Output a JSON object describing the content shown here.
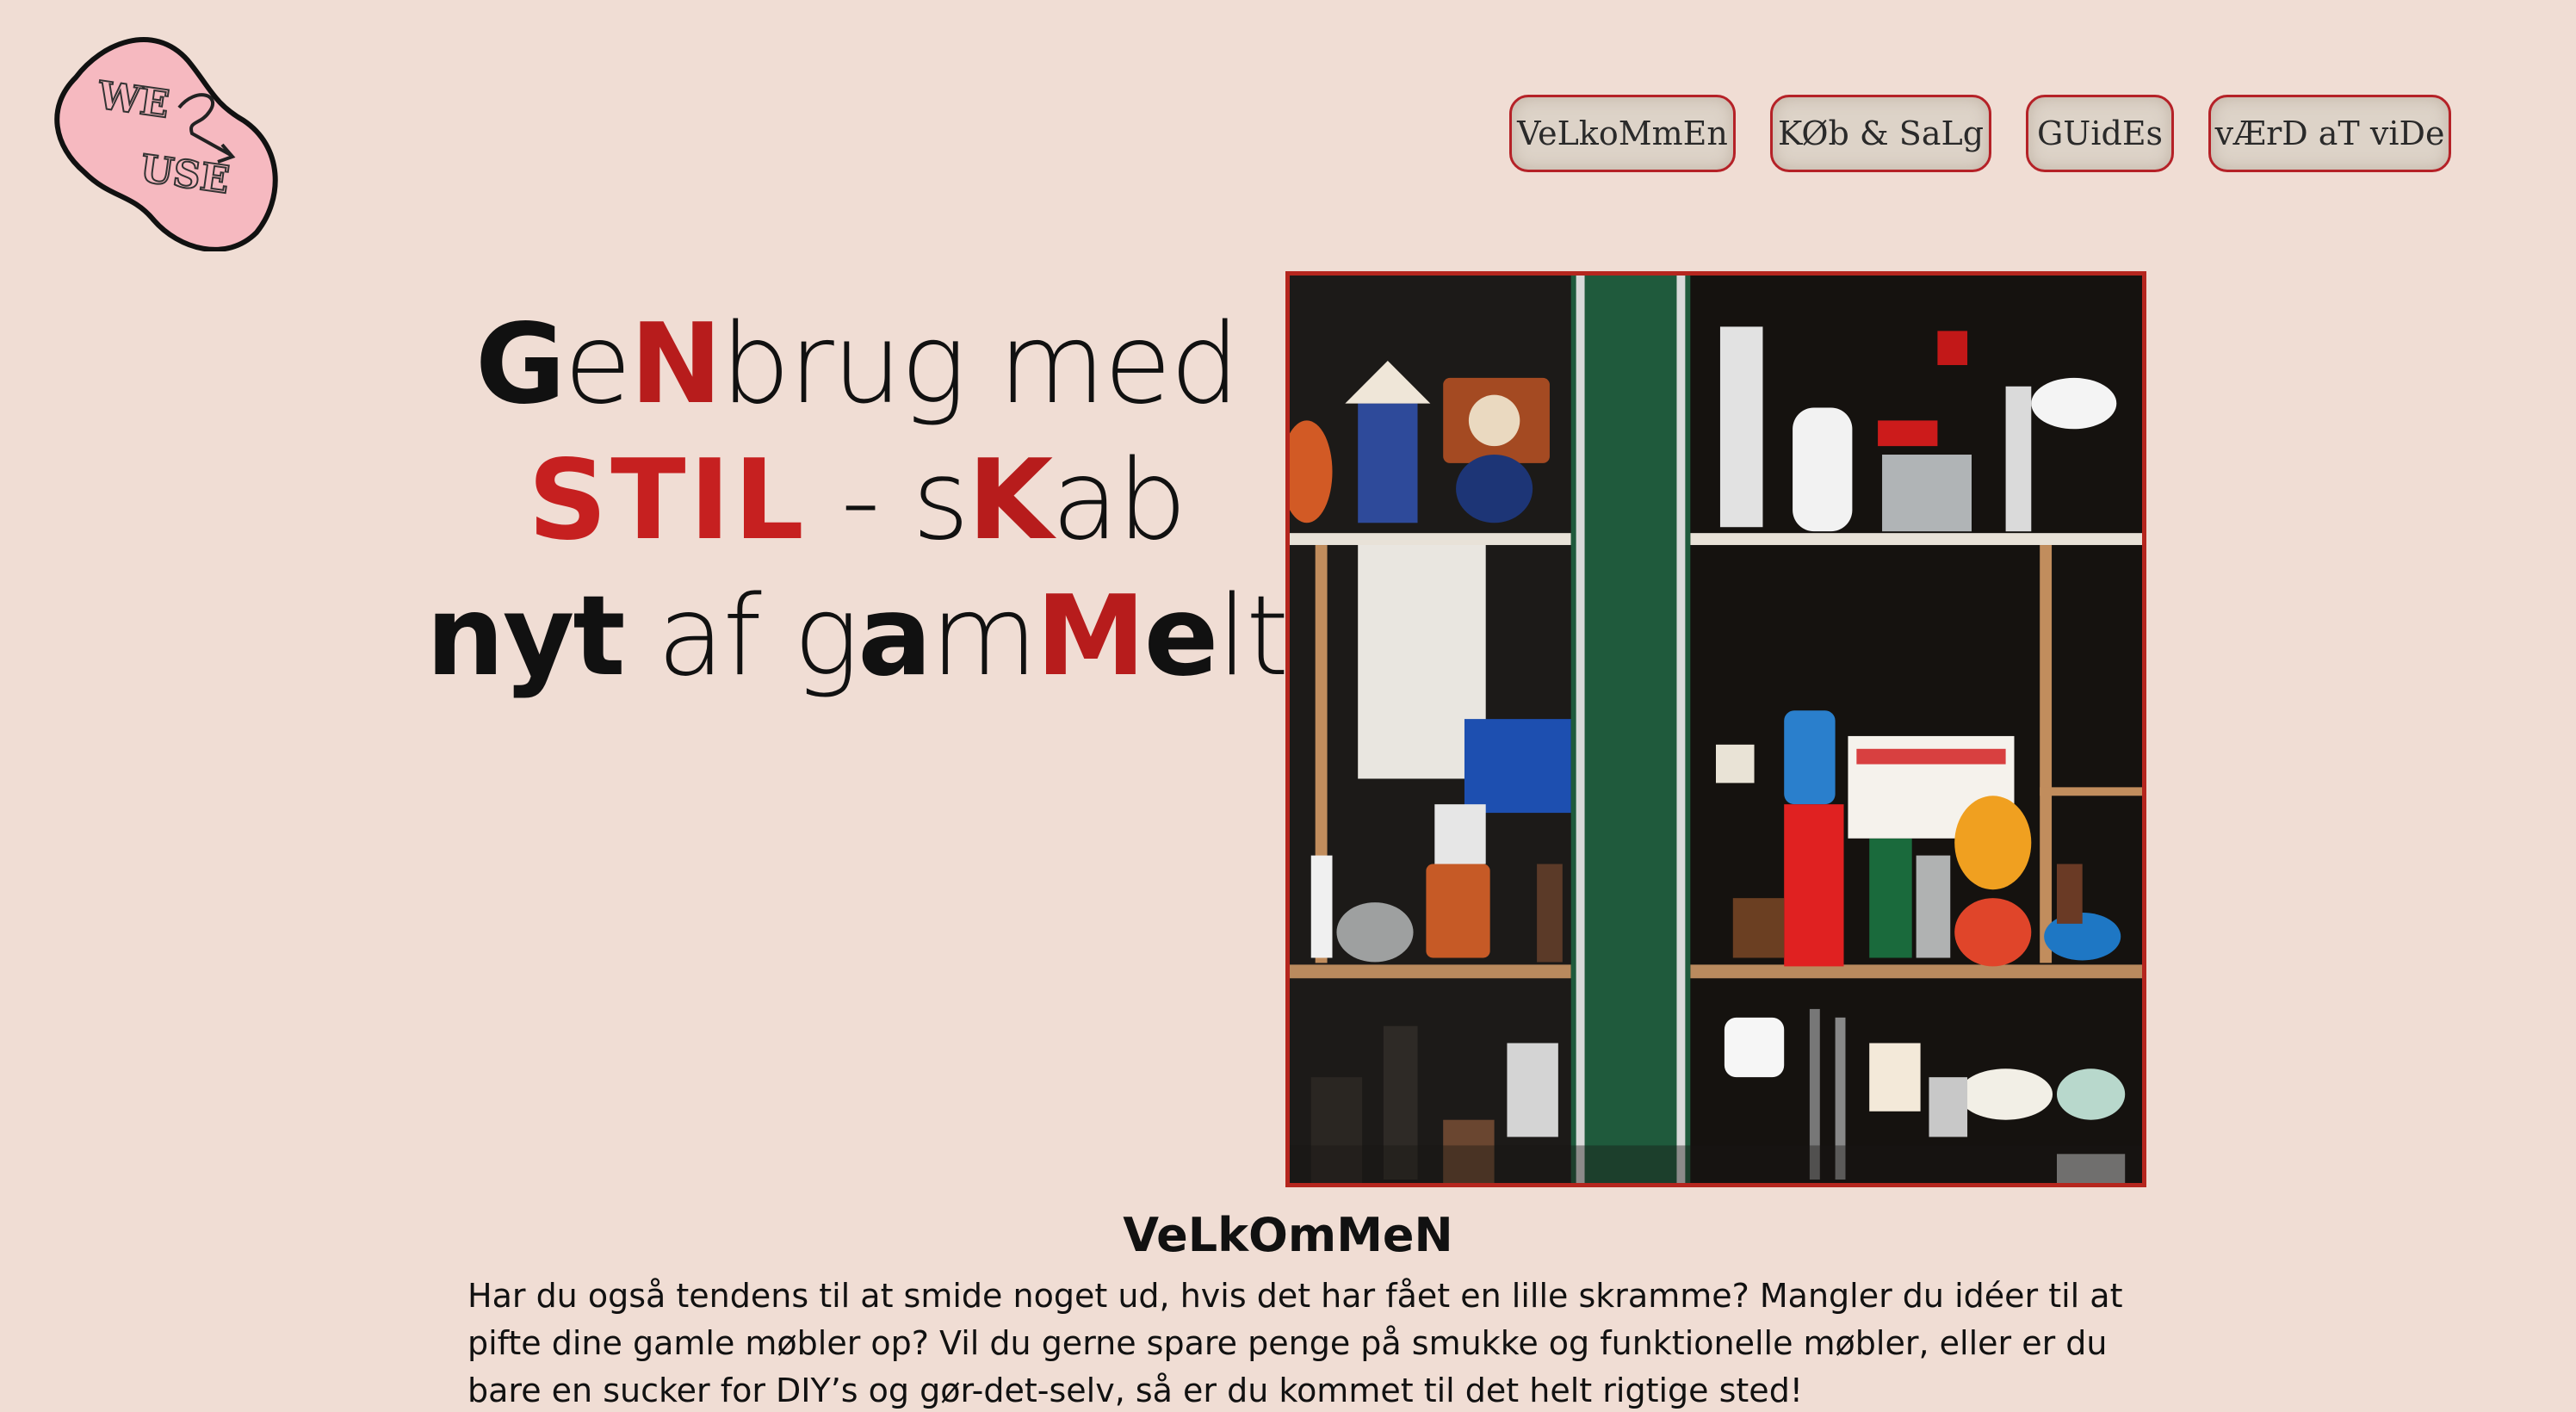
{
  "logo": {
    "text_line1": "WE",
    "text_line2": "USE",
    "icon": "blob-logo-icon"
  },
  "nav": {
    "items": [
      {
        "label": "VeLkoMmEn"
      },
      {
        "label": "KØb & SaLg"
      },
      {
        "label": "GUidEs"
      },
      {
        "label": "vÆrD aT viDe"
      }
    ]
  },
  "hero": {
    "line1": {
      "g": "G",
      "e": "e",
      "n": "N",
      "rest": "brug med"
    },
    "line2": {
      "stil": "STIL",
      "dash": " - s",
      "k": "K",
      "ab": "ab"
    },
    "line3": {
      "nyt": "nyt",
      "af": " af g",
      "a": "a",
      "m": "m",
      "M": "M",
      "e": "e",
      "lt": "lt"
    }
  },
  "photo": {
    "alt": "shop-window-with-vintage-items"
  },
  "welcome": {
    "title": "VeLkOmMeN",
    "body": "Har du også tendens til at smide noget ud, hvis det har fået en lille skramme? Mangler du idéer til at pifte dine gamle møbler op? Vil du gerne spare penge på smukke og funktionelle møbler, eller er du bare en sucker for DIY’s og gør-det-selv, så er du kommet til det helt rigtige sted!"
  },
  "colors": {
    "background": "#f0ddd4",
    "accent_red": "#b71c1c",
    "logo_pink": "#f6b9c0"
  }
}
